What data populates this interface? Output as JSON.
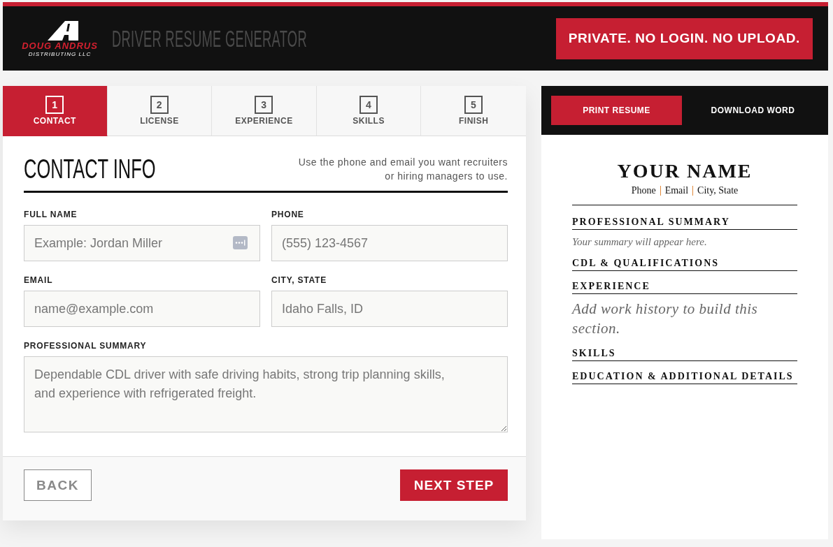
{
  "header": {
    "logo": {
      "name": "DOUG ANDRUS",
      "subtitle": "DISTRIBUTING LLC"
    },
    "title": "DRIVER RESUME GENERATOR",
    "badge": "PRIVATE. NO LOGIN. NO UPLOAD."
  },
  "steps": [
    {
      "number": "1",
      "label": "CONTACT",
      "selected": true
    },
    {
      "number": "2",
      "label": "LICENSE",
      "selected": false
    },
    {
      "number": "3",
      "label": "EXPERIENCE",
      "selected": false
    },
    {
      "number": "4",
      "label": "SKILLS",
      "selected": false
    },
    {
      "number": "5",
      "label": "FINISH",
      "selected": false
    }
  ],
  "section": {
    "title": "CONTACT INFO",
    "hint": "Use the phone and email you want recruiters or hiring managers to use."
  },
  "fields": [
    {
      "kind": "input",
      "label": "FULL NAME",
      "placeholder": "Example: Jordan Miller",
      "autofill_icon": true
    },
    {
      "kind": "input",
      "label": "PHONE",
      "placeholder": "(555) 123-4567",
      "autofill_icon": false
    },
    {
      "kind": "input",
      "label": "EMAIL",
      "placeholder": "name@example.com",
      "autofill_icon": false
    },
    {
      "kind": "input",
      "label": "CITY, STATE",
      "placeholder": "Idaho Falls, ID",
      "autofill_icon": false
    },
    {
      "kind": "textarea",
      "label": "PROFESSIONAL SUMMARY",
      "placeholder": "Dependable CDL driver with safe driving habits, strong trip planning skills, and experience with refrigerated freight.",
      "autofill_icon": false
    }
  ],
  "footer": {
    "buttons": [
      {
        "kind": "secondary",
        "label": "BACK"
      },
      {
        "kind": "primary",
        "label": "NEXT STEP"
      }
    ]
  },
  "preview": {
    "actions": [
      {
        "kind": "primary",
        "label": "PRINT RESUME"
      },
      {
        "kind": "plain",
        "label": "DOWNLOAD WORD"
      }
    ],
    "resume": {
      "name": "YOUR NAME",
      "contact": [
        "Phone",
        "Email",
        "City, State"
      ],
      "sections": [
        {
          "kind": "note",
          "heading": "PROFESSIONAL SUMMARY",
          "note": "Your summary will appear here."
        },
        {
          "kind": "empty",
          "heading": "CDL & QUALIFICATIONS"
        },
        {
          "kind": "prompt",
          "heading": "EXPERIENCE",
          "note": "Add work history to build this section."
        },
        {
          "kind": "empty",
          "heading": "SKILLS"
        },
        {
          "kind": "empty",
          "heading": "EDUCATION & ADDITIONAL DETAILS"
        }
      ]
    }
  }
}
